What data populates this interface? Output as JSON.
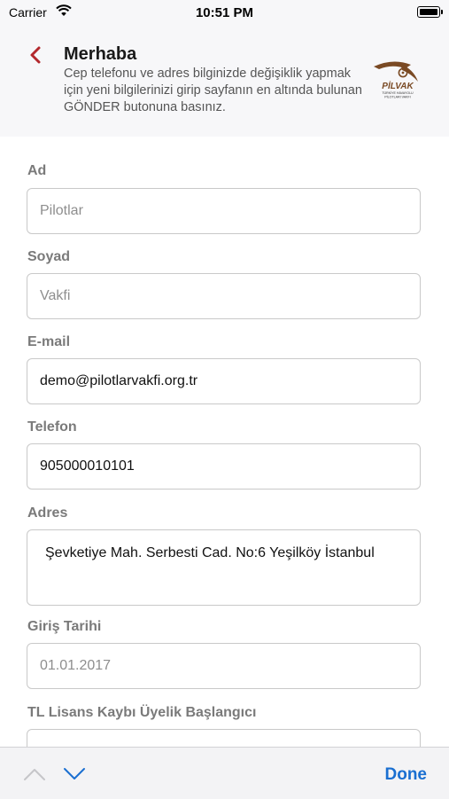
{
  "status_bar": {
    "carrier": "Carrier",
    "time": "10:51 PM"
  },
  "header": {
    "title": "Merhaba",
    "description": "Cep telefonu ve adres bilginizde değişiklik yapmak için yeni bilgilerinizi girip sayfanın en altında bulunan GÖNDER butonuna basınız.",
    "logo": {
      "wordmark": "PİLVAK",
      "tagline_1": "TÜRKİYE HAVAYOLU",
      "tagline_2": "PİLOTLARI VAKFI"
    }
  },
  "form": {
    "fields": [
      {
        "label": "Ad",
        "value": "Pilotlar"
      },
      {
        "label": "Soyad",
        "value": "Vakfi"
      },
      {
        "label": "E-mail",
        "value": "demo@pilotlarvakfi.org.tr"
      },
      {
        "label": "Telefon",
        "value": "905000010101"
      },
      {
        "label": "Adres",
        "value": "Şevketiye Mah. Serbesti Cad. No:6 Yeşilköy İstanbul"
      },
      {
        "label": "Giriş Tarihi",
        "value": "01.01.2017"
      },
      {
        "label": "TL Lisans Kaybı Üyelik Başlangıcı",
        "value": ""
      }
    ]
  },
  "keyboard_toolbar": {
    "done_label": "Done"
  },
  "colors": {
    "accent": "#1a6fd1",
    "back_chevron": "#b3282d",
    "logo_brown": "#7a4a24"
  }
}
